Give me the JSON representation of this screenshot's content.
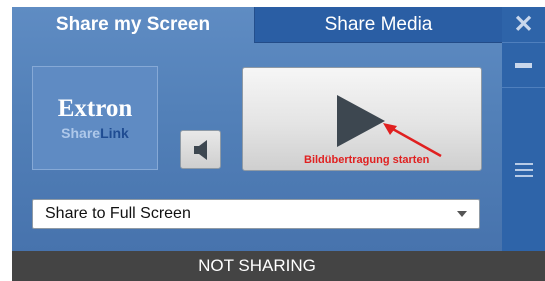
{
  "tabs": {
    "share_screen_label": "Share my Screen",
    "share_media_label": "Share Media"
  },
  "window_controls": {
    "close_glyph": "✕"
  },
  "logo": {
    "title": "Extron",
    "sub_light": "Share",
    "sub_strong": "Link"
  },
  "play_button": {
    "hint_label": "Bildübertragung starten",
    "hint_color": "#e02020"
  },
  "share_dropdown": {
    "selected": "Share to Full Screen"
  },
  "status": {
    "text": "NOT SHARING"
  },
  "icons": {
    "close": "close-icon",
    "minimize": "minimize-icon",
    "menu": "menu-icon",
    "speaker": "speaker-icon",
    "play": "play-icon",
    "arrow": "annotation-arrow-icon",
    "caret": "chevron-down-icon"
  },
  "colors": {
    "panel": "#5280b8",
    "tab_inactive": "#2a5ea4",
    "side_bar": "#2e64a9",
    "status_bar": "#444444",
    "play_triangle": "#3d4750"
  }
}
